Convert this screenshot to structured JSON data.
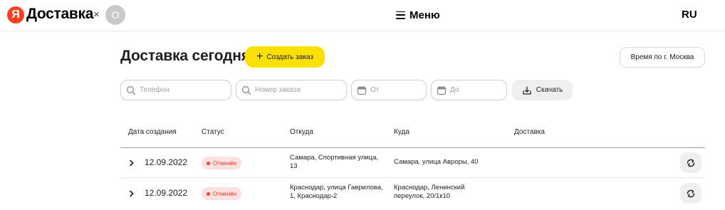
{
  "header": {
    "logo_letter": "Я",
    "brand": "Доставка",
    "separator": "×",
    "partner_avatar_letter": "О",
    "menu_label": "Меню",
    "language": "RU"
  },
  "page": {
    "title": "Доставка сегодня",
    "create_order_label": "Создать заказ",
    "timezone_label": "Время по г. Москва"
  },
  "filters": {
    "phone_placeholder": "Телефон",
    "order_number_placeholder": "Номер заказа",
    "date_from_placeholder": "От",
    "date_to_placeholder": "До",
    "download_label": "Скачать"
  },
  "table": {
    "columns": [
      "Дата создания",
      "Статус",
      "Откуда",
      "Куда",
      "Доставка"
    ],
    "rows": [
      {
        "date": "12.09.2022",
        "status": "Отменён",
        "from": "Самара, Спортивная улица,\n13",
        "to": "Самара, улица Авроры, 40",
        "delivery": ""
      },
      {
        "date": "12.09.2022",
        "status": "Отменён",
        "from": "Краснодар, улица Гаврилова,\n1, Краснодар-2",
        "to": "Краснодар, Ленинский\nпереулок, 20/1к10",
        "delivery": ""
      }
    ]
  },
  "colors": {
    "accent_yellow": "#fce000",
    "logo_red": "#fc3f1d",
    "status_cancelled_text": "#e0382f",
    "status_cancelled_bg": "#fde0e0"
  },
  "icons": {
    "search": "search-icon",
    "calendar": "calendar-icon",
    "download": "download-icon",
    "repeat": "repeat-icon",
    "expand": "chevron-right-icon",
    "menu": "hamburger-icon",
    "plus": "plus-icon"
  }
}
